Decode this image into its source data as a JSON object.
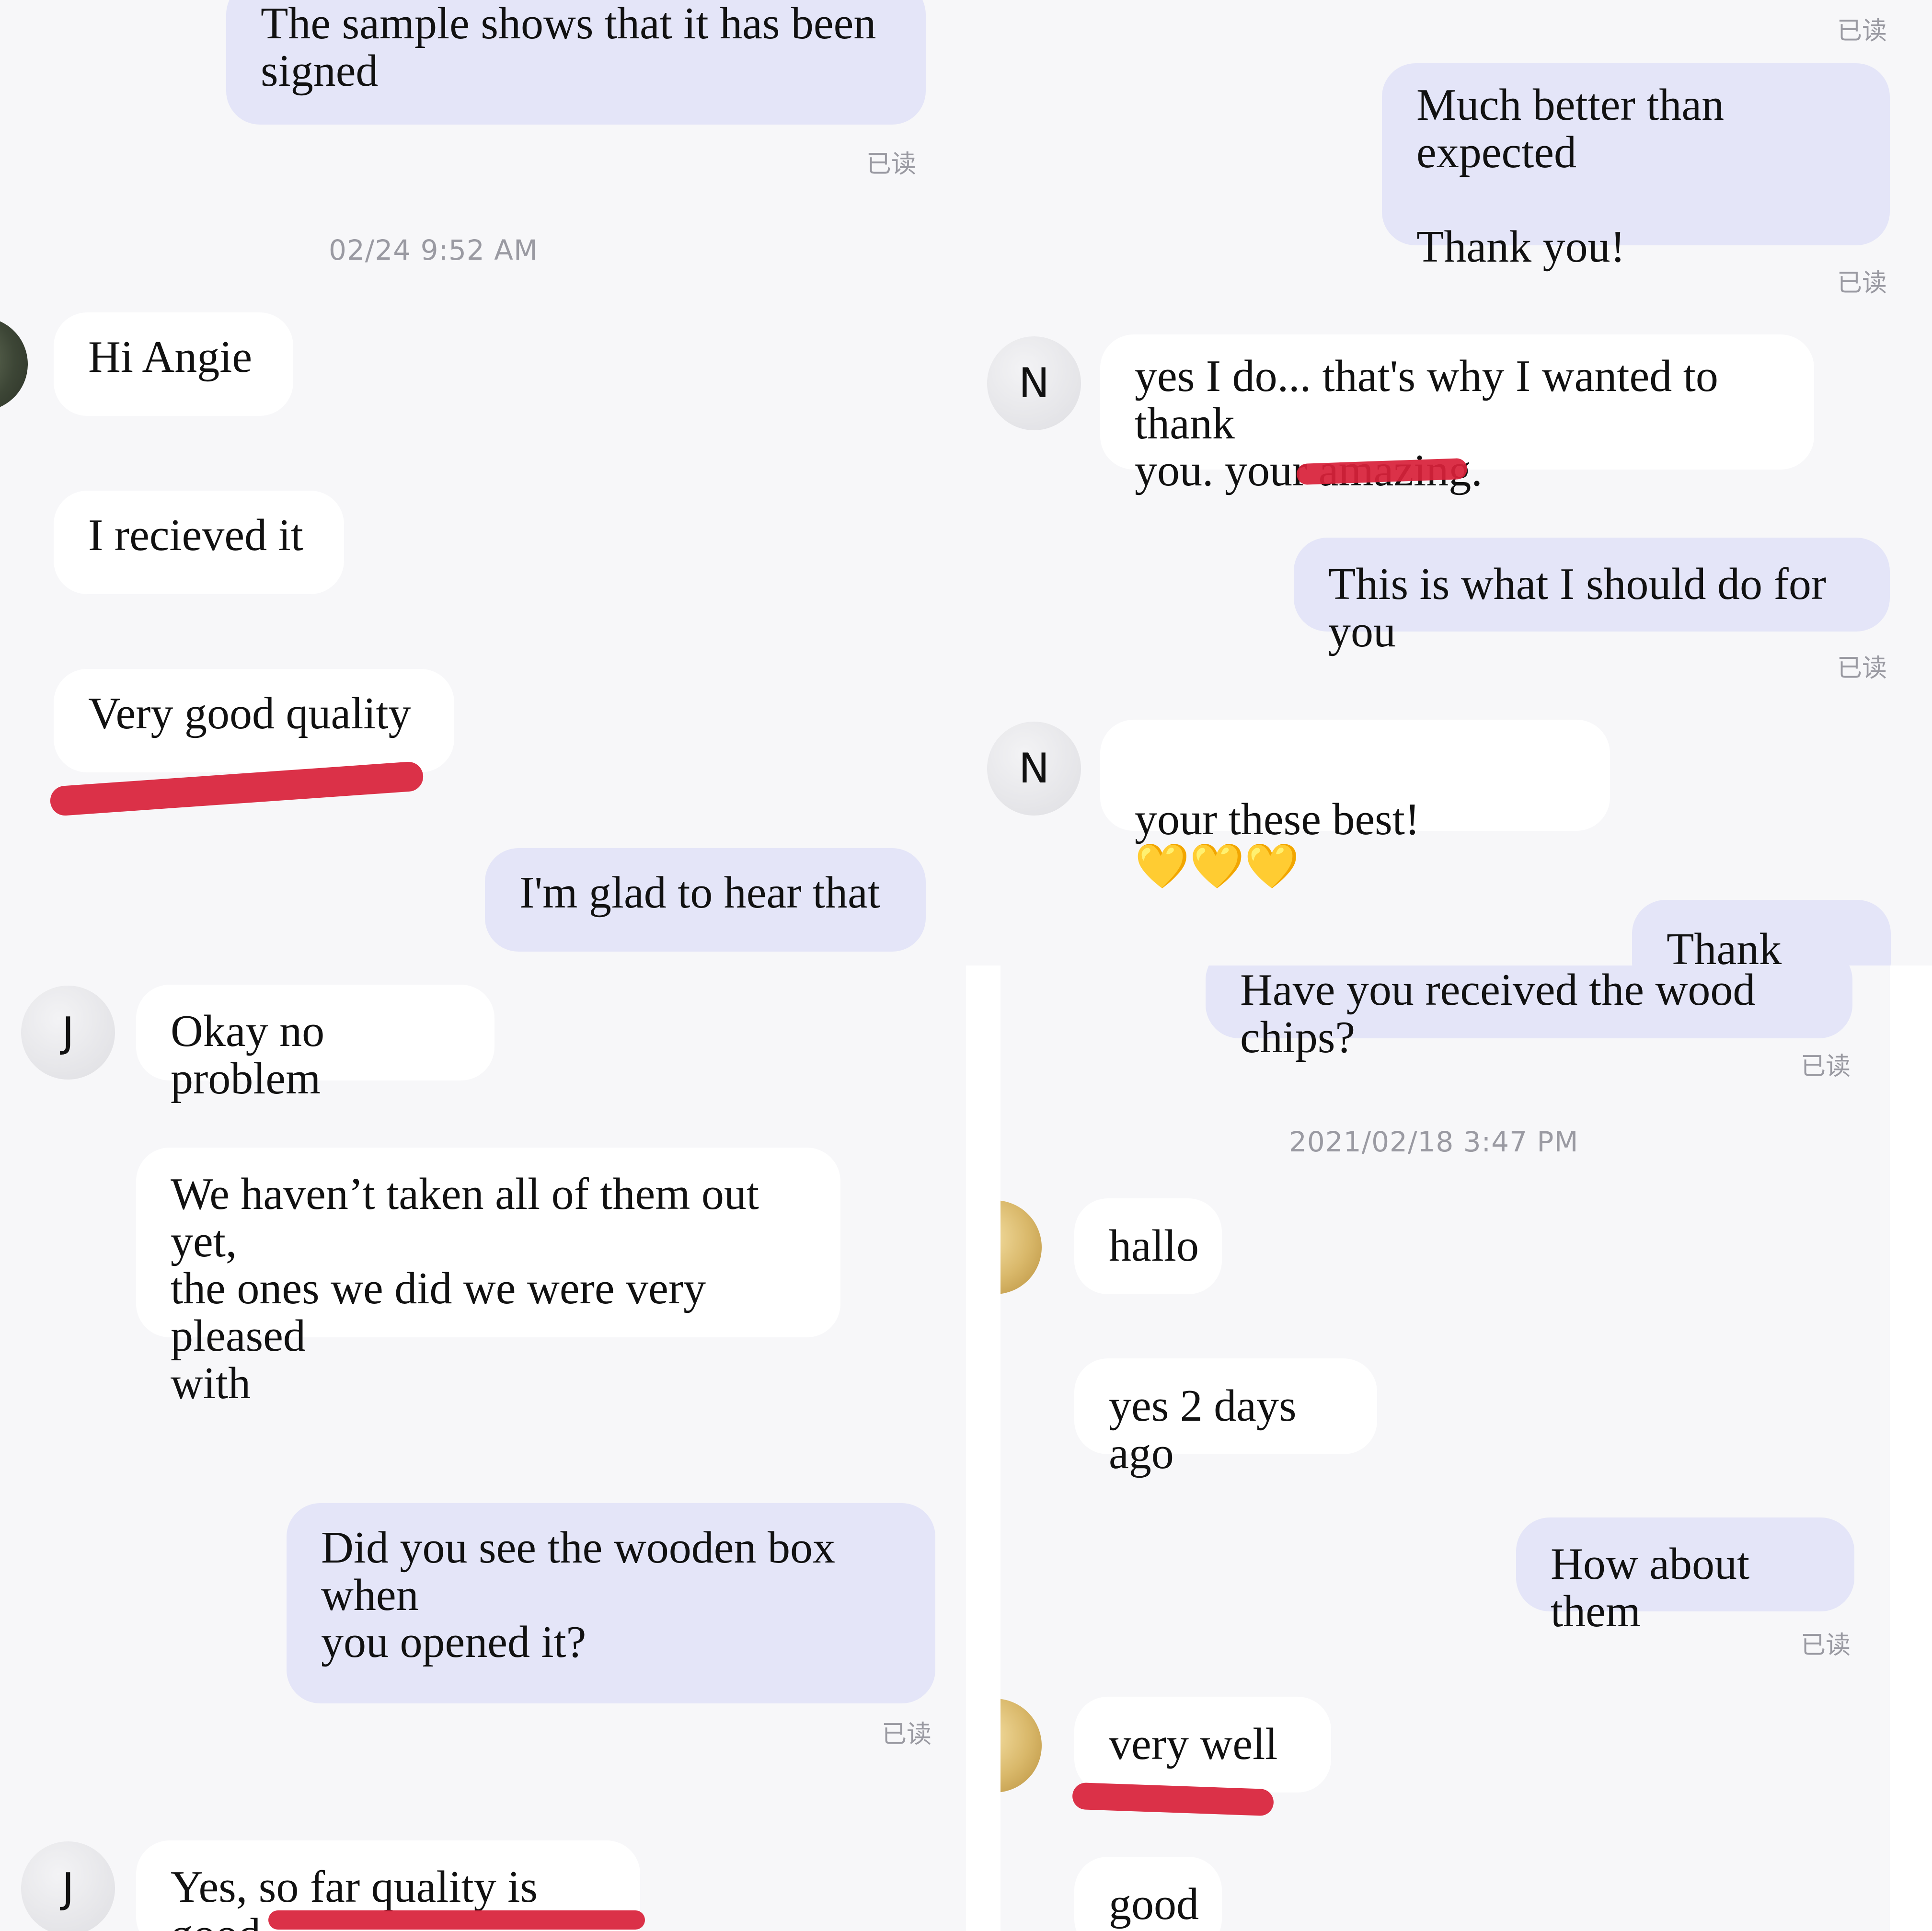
{
  "read_label": "已读",
  "top_left": {
    "messages": [
      {
        "text": "The sample shows that it has been\nsigned"
      },
      {
        "text": "Hi Angie"
      },
      {
        "text": "I recieved it"
      },
      {
        "text": "Very good quality"
      },
      {
        "text": "I'm glad to hear that"
      }
    ],
    "timestamp": "02/24 9:52 AM"
  },
  "top_right": {
    "messages": [
      {
        "text": "Much better than expected\n\nThank you!"
      },
      {
        "text": "yes I do... that's why I wanted to thank\nyou. your amazing."
      },
      {
        "text": "This is what I should do for you"
      },
      {
        "text": "your these best!",
        "emoji": "💛💛💛"
      },
      {
        "text": "Thank you!"
      }
    ],
    "avatar_initial": "N"
  },
  "bottom_left": {
    "avatar_initial": "J",
    "messages": [
      {
        "text": "Okay no problem"
      },
      {
        "text": "We haven’t taken all of them out yet,\nthe ones we did we were very pleased\nwith"
      },
      {
        "text": "Did you see the wooden box when\nyou opened it?"
      },
      {
        "text": "Yes, so far quality is good"
      }
    ]
  },
  "bottom_right": {
    "timestamp": "2021/02/18 3:47 PM",
    "messages": [
      {
        "text": "Have you received the wood chips?"
      },
      {
        "text": "hallo"
      },
      {
        "text": "yes 2 days ago"
      },
      {
        "text": "How about them"
      },
      {
        "text": "very well"
      },
      {
        "text": "good"
      }
    ]
  },
  "colors": {
    "incoming_bubble": "#ffffff",
    "outgoing_bubble": "#e4e5f8",
    "highlight_mark": "#d8213a",
    "read_label": "#9a9aa2"
  }
}
